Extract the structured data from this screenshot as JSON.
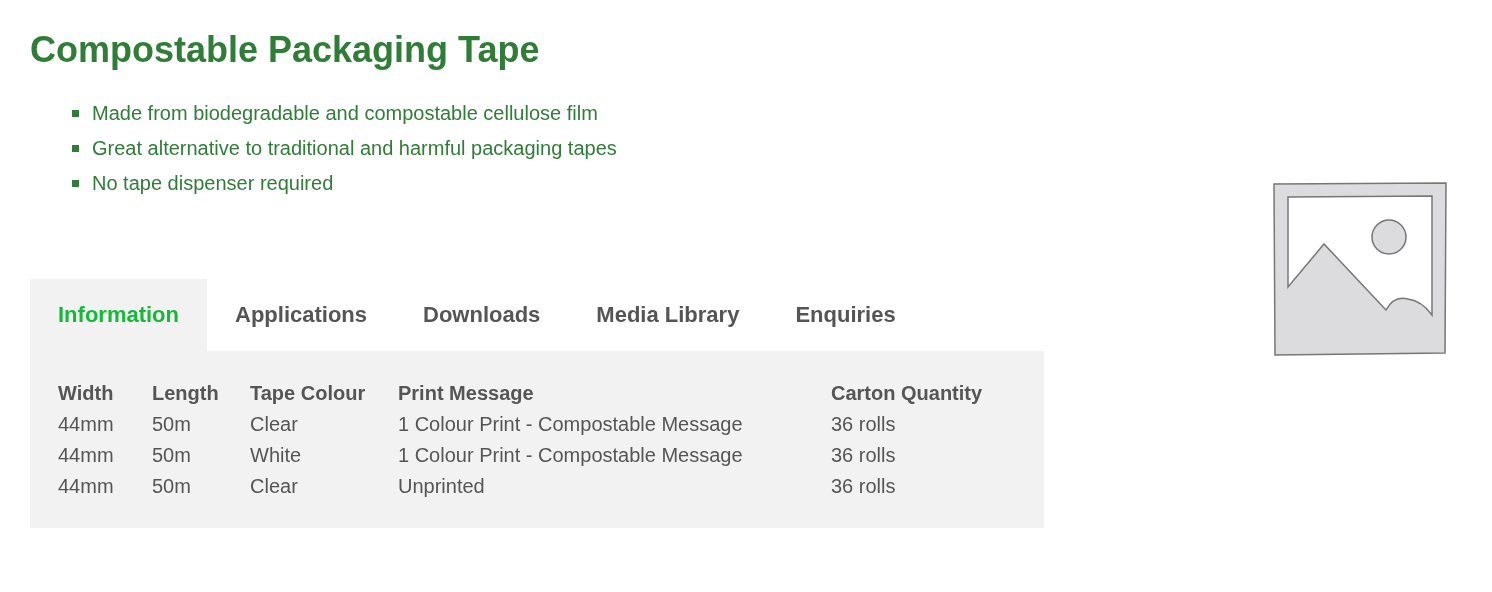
{
  "title": "Compostable Packaging Tape",
  "features": [
    "Made from biodegradable and compostable cellulose film",
    "Great alternative to traditional and harmful packaging tapes",
    "No tape dispenser required"
  ],
  "tabs": [
    {
      "label": "Information",
      "selected": true
    },
    {
      "label": "Applications",
      "selected": false
    },
    {
      "label": "Downloads",
      "selected": false
    },
    {
      "label": "Media Library",
      "selected": false
    },
    {
      "label": "Enquiries",
      "selected": false
    }
  ],
  "table": {
    "columns": [
      "Width",
      "Length",
      "Tape Colour",
      "Print Message",
      "Carton Quantity"
    ],
    "rows": [
      [
        "44mm",
        "50m",
        "Clear",
        "1 Colour Print - Compostable Message",
        "36 rolls"
      ],
      [
        "44mm",
        "50m",
        "White",
        "1 Colour Print - Compostable Message",
        "36 rolls"
      ],
      [
        "44mm",
        "50m",
        "Clear",
        "Unprinted",
        "36 rolls"
      ]
    ]
  }
}
